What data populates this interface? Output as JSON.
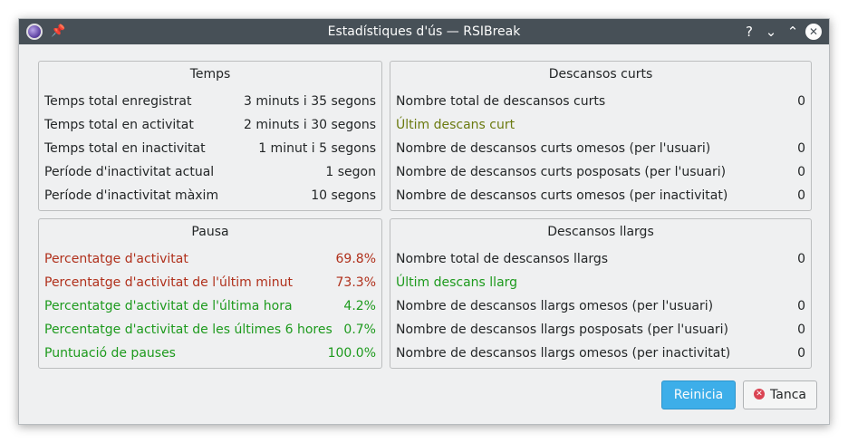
{
  "window": {
    "title": "Estadístiques d'ús — RSIBreak",
    "help_glyph": "?",
    "min_glyph": "⌄",
    "max_glyph": "⌃",
    "close_glyph": "✕"
  },
  "temps": {
    "title": "Temps",
    "rows": [
      {
        "label": "Temps total enregistrat",
        "value": "3 minuts i 35 segons"
      },
      {
        "label": "Temps total en activitat",
        "value": "2 minuts i 30 segons"
      },
      {
        "label": "Temps total en inactivitat",
        "value": "1 minut i 5 segons"
      },
      {
        "label": "Període d'inactivitat actual",
        "value": "1 segon"
      },
      {
        "label": "Període d'inactivitat màxim",
        "value": "10 segons"
      }
    ]
  },
  "curts": {
    "title": "Descansos curts",
    "rows": [
      {
        "label": "Nombre total de descansos curts",
        "value": "0"
      },
      {
        "label": "Últim descans curt",
        "value": ""
      },
      {
        "label": "Nombre de descansos curts omesos (per l'usuari)",
        "value": "0"
      },
      {
        "label": "Nombre de descansos curts posposats (per l'usuari)",
        "value": "0"
      },
      {
        "label": "Nombre de descansos curts omesos (per inactivitat)",
        "value": "0"
      }
    ]
  },
  "pausa": {
    "title": "Pausa",
    "rows": [
      {
        "label": "Percentatge d'activitat",
        "value": "69.8%"
      },
      {
        "label": "Percentatge d'activitat de l'últim minut",
        "value": "73.3%"
      },
      {
        "label": "Percentatge d'activitat de l'última hora",
        "value": "4.2%"
      },
      {
        "label": "Percentatge d'activitat de les últimes 6 hores",
        "value": "0.7%"
      },
      {
        "label": "Puntuació de pauses",
        "value": "100.0%"
      }
    ]
  },
  "llargs": {
    "title": "Descansos llargs",
    "rows": [
      {
        "label": "Nombre total de descansos llargs",
        "value": "0"
      },
      {
        "label": "Últim descans llarg",
        "value": ""
      },
      {
        "label": "Nombre de descansos llargs omesos (per l'usuari)",
        "value": "0"
      },
      {
        "label": "Nombre de descansos llargs posposats (per l'usuari)",
        "value": "0"
      },
      {
        "label": "Nombre de descansos llargs omesos (per inactivitat)",
        "value": "0"
      }
    ]
  },
  "buttons": {
    "reset": "Reinicia",
    "close": "Tanca"
  },
  "colors": {
    "titlebar": "#475057",
    "accent": "#3daee9",
    "warning_red": "#b0301b",
    "ok_green": "#1d9a1d",
    "olive": "#6b7a10"
  }
}
